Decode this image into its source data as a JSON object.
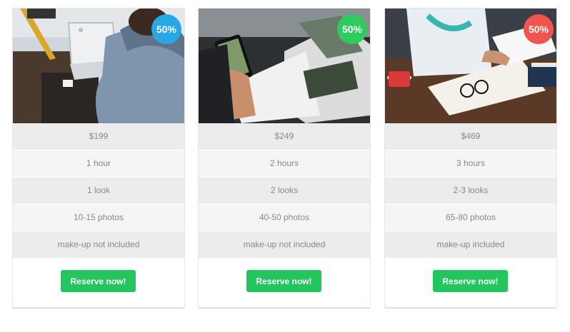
{
  "colors": {
    "accent_green": "#22c55e",
    "badge_blue": "#27a7e7",
    "badge_green": "#2ecc5f",
    "badge_red": "#f0544f",
    "row_dark": "#ececec",
    "row_light": "#f5f5f5",
    "text_muted": "#888888"
  },
  "cards": [
    {
      "photo_icon": "laptop-photo-icon",
      "badge": "50%",
      "price": "$199",
      "duration": "1 hour",
      "looks": "1 look",
      "photos": "10-15 photos",
      "makeup": "make-up not included",
      "button": "Reserve now!"
    },
    {
      "photo_icon": "magazine-phone-photo-icon",
      "badge": "50%",
      "price": "$249",
      "duration": "2 hours",
      "looks": "2 looks",
      "photos": "40-50 photos",
      "makeup": "make-up not included",
      "button": "Reserve now!"
    },
    {
      "photo_icon": "notebook-desk-photo-icon",
      "badge": "50%",
      "price": "$469",
      "duration": "3 hours",
      "looks": "2-3 looks",
      "photos": "65-80 photos",
      "makeup": "make-up included",
      "button": "Reserve now!"
    }
  ]
}
